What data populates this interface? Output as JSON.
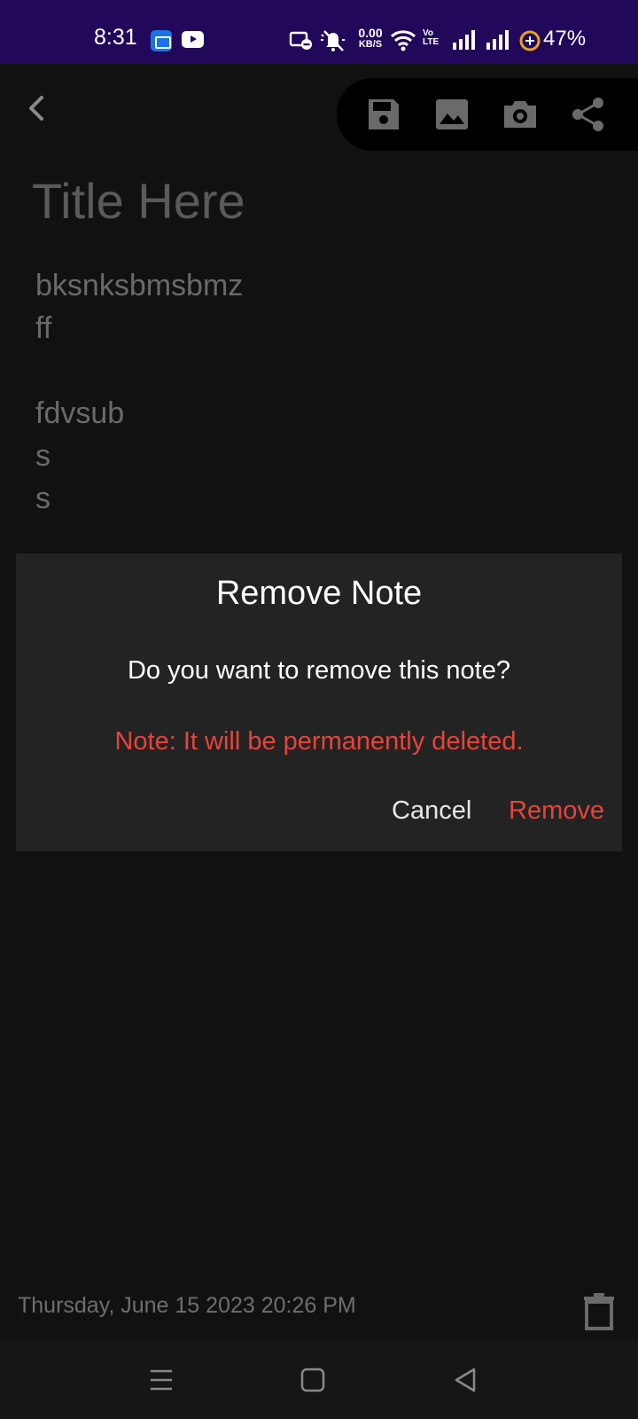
{
  "status_bar": {
    "time": "8:31",
    "speed_value": "0.00",
    "speed_unit": "KB/S",
    "volte_line1": "Vo",
    "volte_line2": "LTE",
    "battery": "47%",
    "icons": [
      "app-notification-icon",
      "youtube-icon",
      "cast-icon",
      "mute-icon",
      "wifi-icon",
      "signal-icon",
      "signal-icon",
      "battery-saver-icon"
    ]
  },
  "toolbar": {
    "buttons": [
      "save-icon",
      "image-icon",
      "camera-icon",
      "share-icon"
    ]
  },
  "note": {
    "title_placeholder": "Title Here",
    "body": "bksnksbmsbmz\nff\n\nfdvsub\ns\ns",
    "date": "Thursday, June 15 2023 20:26 PM"
  },
  "dialog": {
    "title": "Remove Note",
    "message": "Do you want to remove this note?",
    "warning": "Note: It will be permanently deleted.",
    "cancel_label": "Cancel",
    "remove_label": "Remove"
  },
  "colors": {
    "accent_red": "#e8433a",
    "status_bar_bg": "#22085a",
    "dialog_bg": "#232323"
  },
  "nav_bar": {
    "buttons": [
      "menu-icon",
      "home-icon",
      "back-icon"
    ]
  }
}
